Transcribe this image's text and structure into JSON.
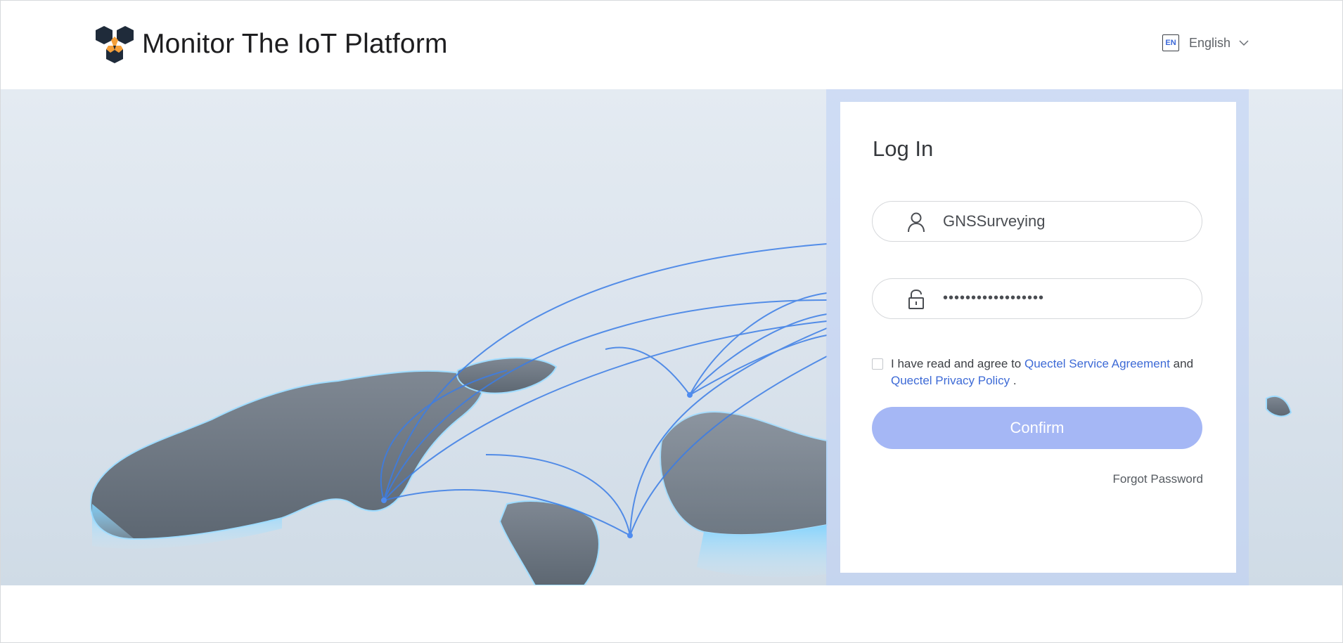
{
  "header": {
    "title": "Monitor The IoT Platform",
    "language": {
      "badge": "EN",
      "label": "English"
    }
  },
  "login": {
    "title": "Log In",
    "username": {
      "value": "GNSSurveying"
    },
    "password": {
      "masked_value": "••••••••••••••••••"
    },
    "agreement": {
      "prefix": "I have read and agree to",
      "service_link": "Quectel Service Agreement",
      "conjunction": "and",
      "privacy_link": "Quectel Privacy Policy",
      "suffix": ".",
      "checked": false
    },
    "confirm_label": "Confirm",
    "forgot_label": "Forgot Password"
  },
  "colors": {
    "accent": "#3d6ad6",
    "confirm_bg": "#a5b7f5",
    "logo_dark": "#1f2b3a",
    "logo_orange": "#f5a03a"
  },
  "icons": {
    "logo": "hexagon-cube-logo",
    "language": "en-badge-icon",
    "dropdown": "chevron-down-icon",
    "user": "user-icon",
    "lock": "unlock-icon"
  }
}
